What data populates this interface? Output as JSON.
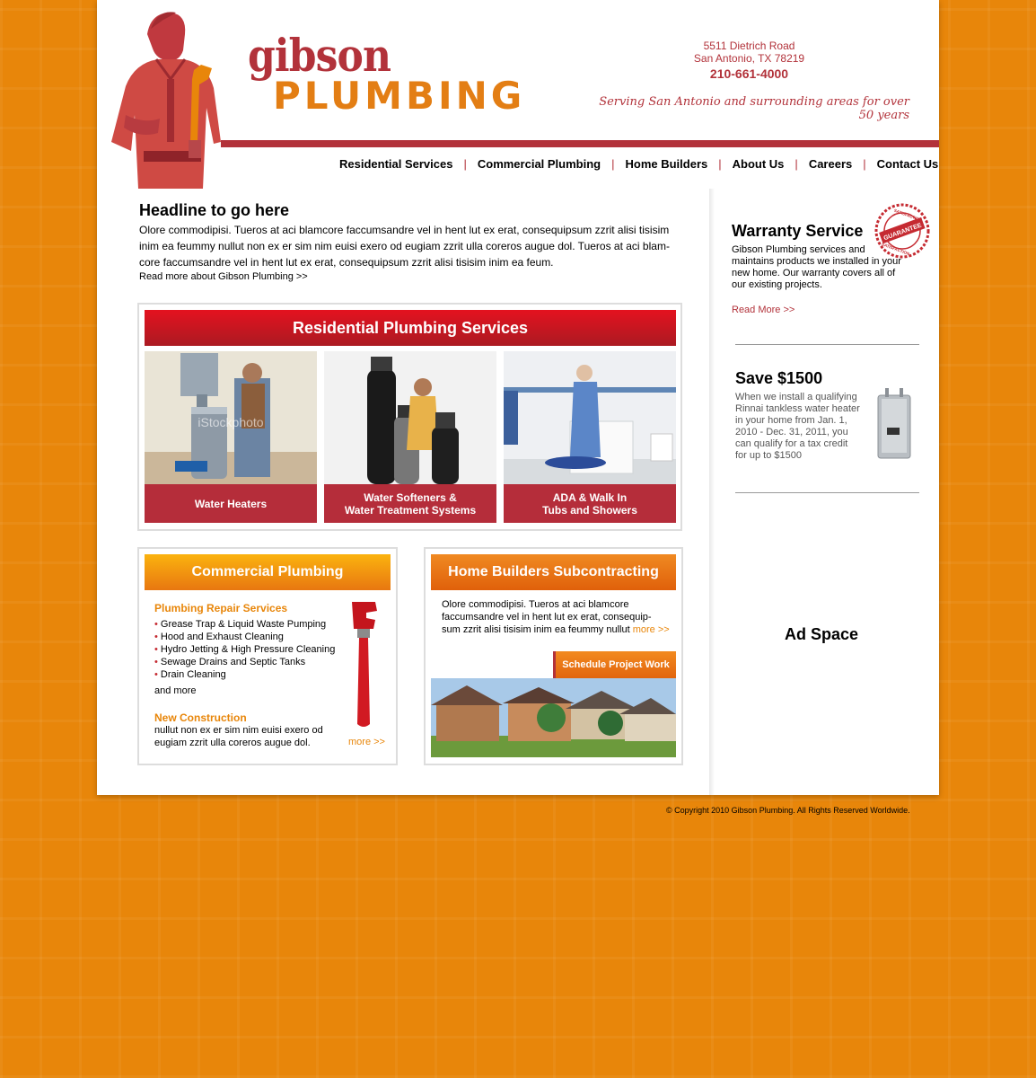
{
  "header": {
    "logo_line1": "gibson",
    "logo_line2": "PLUMBING",
    "address_line1": "5511 Dietrich Road",
    "address_line2": "San Antonio, TX 78219",
    "phone": "210-661-4000",
    "tagline": "Serving San Antonio and surrounding areas for over 50 years"
  },
  "nav": {
    "items": [
      "Residential Services",
      "Commercial Plumbing",
      "Home Builders",
      "About Us",
      "Careers",
      "Contact Us"
    ],
    "separator": "|"
  },
  "intro": {
    "headline": "Headline to go here",
    "body": "Olore commodipisi. Tueros at aci blamcore faccumsandre vel in hent lut ex erat, consequipsum zzrit alisi tisisim inim ea feummy nullut non ex er sim nim euisi exero od eugiam zzrit ulla coreros augue dol. Tueros at aci blam-core faccumsandre vel in hent lut ex erat, consequipsum zzrit alisi tisisim inim ea feum.",
    "read_more": "Read more about Gibson Plumbing >>"
  },
  "residential": {
    "title": "Residential Plumbing Services",
    "tiles": [
      {
        "line1": "Water Heaters",
        "line2": ""
      },
      {
        "line1": "Water Softeners &",
        "line2": "Water Treatment Systems"
      },
      {
        "line1": "ADA & Walk In",
        "line2": "Tubs and Showers"
      }
    ],
    "watermark": "iStockphoto"
  },
  "commercial": {
    "title": "Commercial Plumbing",
    "repair_heading": "Plumbing Repair Services",
    "bullets": [
      "Grease Trap & Liquid Waste Pumping",
      "Hood and Exhaust Cleaning",
      "Hydro Jetting & High Pressure Cleaning",
      "Sewage Drains and Septic Tanks",
      "Drain Cleaning"
    ],
    "bullet_mark": "•",
    "and_more": "and more",
    "new_heading": "New Construction",
    "new_line1": "nullut non ex er sim nim euisi exero od",
    "new_line2": "eugiam zzrit ulla coreros augue dol.",
    "more": "more >>"
  },
  "home_builders": {
    "title": "Home Builders Subcontracting",
    "line1": "Olore commodipisi. Tueros at aci blamcore",
    "line2": "faccumsandre vel in hent lut ex erat, consequip-",
    "line3": "sum zzrit alisi tisisim inim ea feummy nullut",
    "more": "more >>",
    "button": "Schedule Project Work"
  },
  "sidebar": {
    "warranty_title": "Warranty Service",
    "warranty_text": "Gibson Plumbing services and maintains products we installed in your new home. Our warranty covers all of our existing projects.",
    "warranty_read_more": "Read More >>",
    "seal_top": "SATISFACTION",
    "seal_middle": "GUARANTEE",
    "save_title": "Save $1500",
    "save_text": "When we install a qualifying Rinnai tankless water heater in your home from Jan. 1, 2010 - Dec. 31, 2011, you can qualify for a tax credit for up to $1500",
    "ad_space": "Ad Space"
  },
  "footer": {
    "copyright": "© Copyright 2010 Gibson Plumbing. All Rights Reserved Worldwide."
  },
  "colors": {
    "brand_red": "#b2323a",
    "brand_orange": "#e8860a",
    "background": "#e8860a"
  },
  "icons": [
    "plumber-mascot-icon",
    "pipe-wrench-icon",
    "guarantee-seal-icon",
    "tankless-heater-icon"
  ]
}
